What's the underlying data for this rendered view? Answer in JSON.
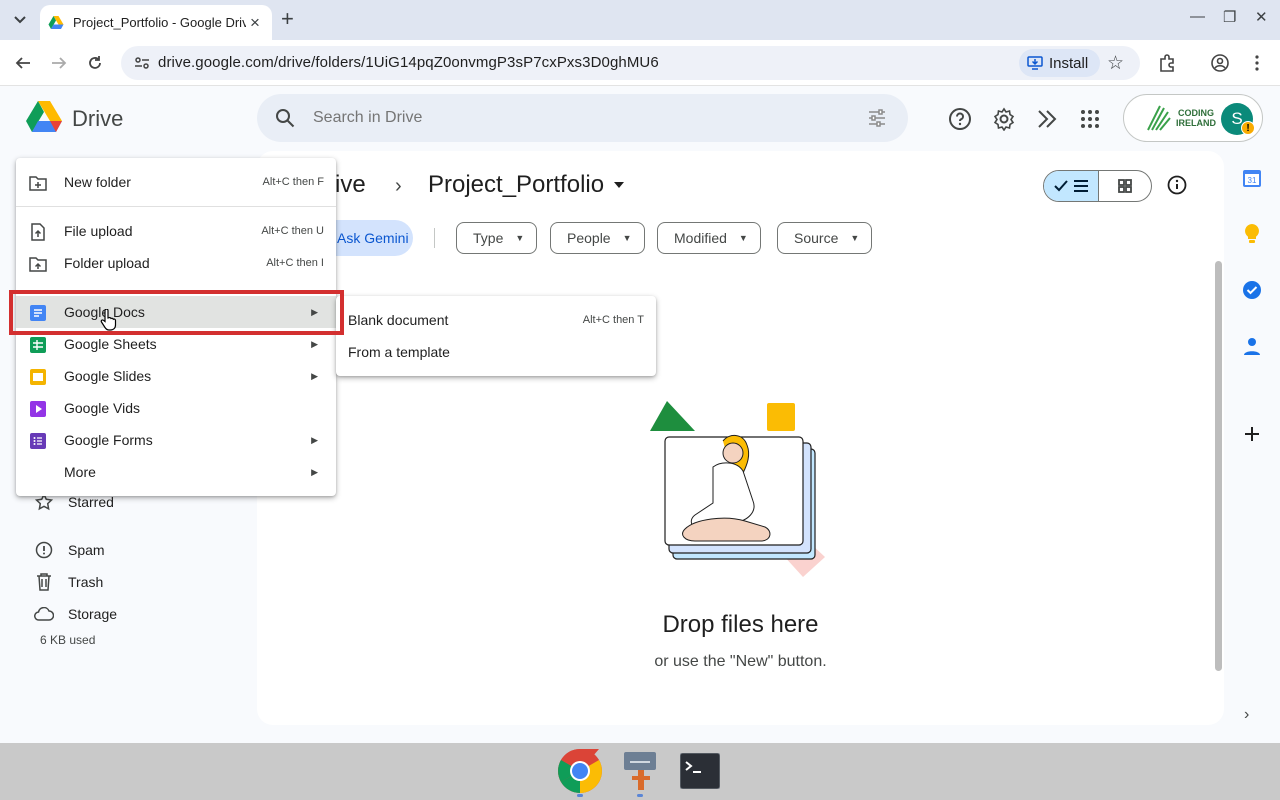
{
  "browser": {
    "tab_title": "Project_Portfolio - Google Drive",
    "url": "drive.google.com/drive/folders/1UiG14pqZ0onvmgP3sP7cxPxs3D0ghMU6",
    "install_label": "Install"
  },
  "header": {
    "app_name": "Drive",
    "search_placeholder": "Search in Drive",
    "org_name_line1": "CODING",
    "org_name_line2": "IRELAND",
    "avatar_initial": "S"
  },
  "breadcrumb": {
    "parent": "My Drive",
    "current": "Project_Portfolio"
  },
  "filters": {
    "gemini_label": "Ask Gemini",
    "chips": [
      "Type",
      "People",
      "Modified",
      "Source"
    ]
  },
  "sidebar": {
    "items": [
      {
        "label": "Starred",
        "icon": "star-icon"
      },
      {
        "label": "Spam",
        "icon": "spam-icon"
      },
      {
        "label": "Trash",
        "icon": "trash-icon"
      },
      {
        "label": "Storage",
        "icon": "cloud-icon"
      }
    ],
    "storage_used": "6 KB used"
  },
  "empty_state": {
    "title": "Drop files here",
    "subtitle": "or use the \"New\" button."
  },
  "new_menu": {
    "items": [
      {
        "label": "New folder",
        "shortcut": "Alt+C then F"
      },
      {
        "label": "File upload",
        "shortcut": "Alt+C then U"
      },
      {
        "label": "Folder upload",
        "shortcut": "Alt+C then I"
      },
      {
        "label": "Google Docs",
        "shortcut": ""
      },
      {
        "label": "Google Sheets",
        "shortcut": ""
      },
      {
        "label": "Google Slides",
        "shortcut": ""
      },
      {
        "label": "Google Vids",
        "shortcut": ""
      },
      {
        "label": "Google Forms",
        "shortcut": ""
      },
      {
        "label": "More",
        "shortcut": ""
      }
    ]
  },
  "docs_submenu": {
    "items": [
      {
        "label": "Blank document",
        "shortcut": "Alt+C then T"
      },
      {
        "label": "From a template",
        "shortcut": ""
      }
    ]
  },
  "colors": {
    "accent": "#0b57d0",
    "highlight_border": "#d32f2f",
    "docs_blue": "#4285f4",
    "sheets_green": "#0f9d58",
    "slides_yellow": "#f4b400",
    "vids_purple": "#9334e6",
    "forms_purple": "#673ab7"
  }
}
